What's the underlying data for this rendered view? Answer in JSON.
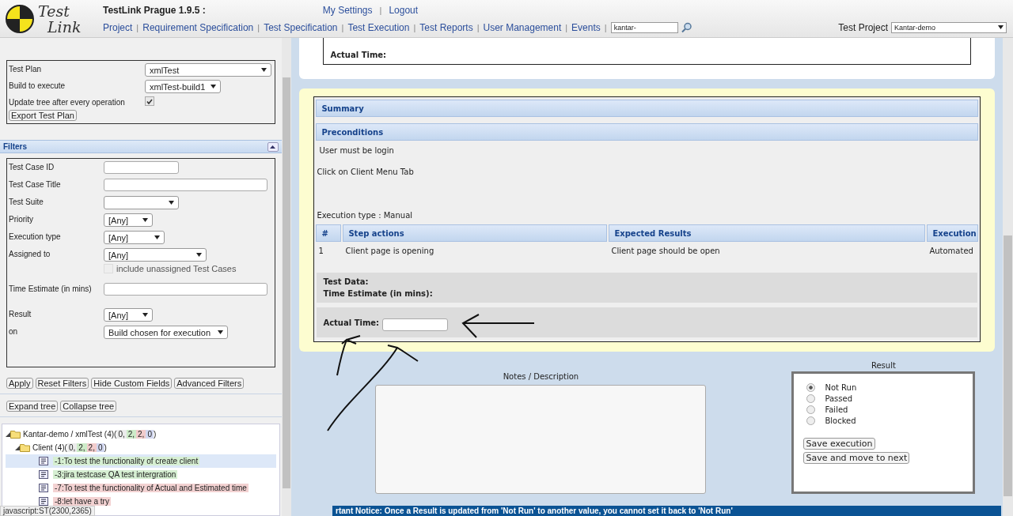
{
  "header": {
    "app_title": "TestLink Prague 1.9.5 :",
    "user_links": [
      {
        "label": "My Settings"
      },
      {
        "label": "Logout"
      }
    ],
    "logo_words": [
      "Test",
      "Link"
    ],
    "separator": "|",
    "nav": [
      "Project",
      "Requirement Specification",
      "Test Specification",
      "Test Execution",
      "Test Reports",
      "User Management",
      "Events"
    ],
    "search": {
      "value": "kantar-"
    },
    "project_label": "Test Project",
    "project": "Kantar-demo"
  },
  "settings": {
    "fields": [
      {
        "label": "Test Plan",
        "value": "xmlTest"
      },
      {
        "label": "Build to execute",
        "value": "xmlTest-build1"
      }
    ],
    "update_tree": {
      "label": "Update tree after every operation",
      "checked": true
    },
    "export_button": "Export Test Plan"
  },
  "filters": {
    "title": "Filters",
    "fields": [
      {
        "kind": "input",
        "label": "Test Case ID"
      },
      {
        "kind": "input",
        "label": "Test Case Title"
      },
      {
        "kind": "select",
        "label": "Test Suite"
      },
      {
        "kind": "select",
        "label": "Priority",
        "value": "[Any]"
      },
      {
        "kind": "select",
        "label": "Execution type",
        "value": "[Any]"
      },
      {
        "kind": "select",
        "label": "Assigned to",
        "value": "[Any]",
        "option": {
          "label": "include unassigned Test Cases",
          "checked": false,
          "disabled": true
        }
      },
      {
        "kind": "input",
        "label": "Time Estimate (in mins)"
      },
      {
        "kind": "select",
        "label": "Result",
        "value": "[Any]"
      },
      {
        "kind": "select",
        "label": "on",
        "value": "Build chosen for execution"
      }
    ],
    "buttons": [
      "Apply",
      "Reset Filters",
      "Hide Custom Fields",
      "Advanced Filters"
    ]
  },
  "tree_buttons": [
    "Expand tree",
    "Collapse tree"
  ],
  "tree": {
    "label": "Kantar-demo / xmlTest (4)(",
    "counts": [
      {
        "value": "0,",
        "color": "#ececec"
      },
      {
        "value": "2,",
        "color": "#cdebc8"
      },
      {
        "value": "2,",
        "color": "#f2cccc"
      },
      {
        "value": "0",
        "color": "#d3d8f0"
      }
    ],
    "close": ")",
    "children": [
      {
        "label": "Client (4)(",
        "counts": [
          {
            "value": "0,",
            "color": "#ececec"
          },
          {
            "value": "2,",
            "color": "#cdebc8"
          },
          {
            "value": "2,",
            "color": "#f2cccc"
          },
          {
            "value": "0",
            "color": "#d3d8f0"
          }
        ],
        "close": ")",
        "children": [
          {
            "label": "-1:To test the functionality of create client",
            "color": "#d6efd2",
            "selected": true
          },
          {
            "label": "-3:jira testcase QA test intergration",
            "color": "#d6efd2",
            "selected": false
          },
          {
            "label": "-7:To test the functionality of Actual and Estimated time",
            "color": "#f3d2d2",
            "selected": false
          },
          {
            "label": "-8:let have a try",
            "color": "#f3d2d2",
            "selected": false
          }
        ]
      }
    ]
  },
  "status_bar": "javascript:ST(2300,2365)",
  "previous_card": {
    "label": "Actual Time:"
  },
  "execution": {
    "sections": [
      "Summary",
      "Preconditions"
    ],
    "precondition": "User must be login",
    "step_note": "Click on Client Menu Tab",
    "execution_type": "Execution type : Manual",
    "columns": [
      "#",
      "Step actions",
      "Expected Results",
      "Execution"
    ],
    "rows": [
      [
        "1",
        "Client page is opening",
        "Client page should be open",
        "Automated"
      ]
    ],
    "test_data": "Test Data:",
    "time_estimate": "Time Estimate (in mins):",
    "actual_time": "Actual Time:"
  },
  "notes": {
    "label": "Notes / Description"
  },
  "result": {
    "title": "Result",
    "options": [
      {
        "label": "Not Run",
        "selected": true
      },
      {
        "label": "Passed",
        "selected": false
      },
      {
        "label": "Failed",
        "selected": false
      },
      {
        "label": "Blocked",
        "selected": false
      }
    ],
    "buttons": [
      "Save execution",
      "Save and move to next"
    ]
  },
  "notice": "rtant Notice: Once a Result is updated from 'Not Run' to another value, you cannot set it back to 'Not Run'"
}
